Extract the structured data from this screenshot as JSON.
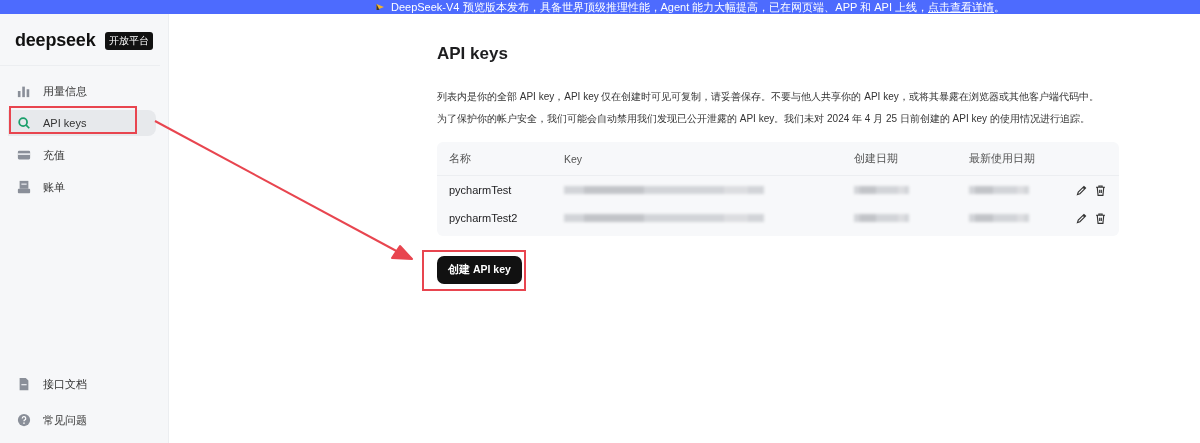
{
  "banner": {
    "text": "DeepSeek-V4 预览版本发布，具备世界顶级推理性能，Agent 能力大幅提高，已在网页端、APP 和 API 上线，",
    "link": "点击查看详情",
    "end": "。"
  },
  "sidebar": {
    "logo": "deepseek",
    "badge": "开放平台",
    "items": [
      {
        "label": "用量信息",
        "kind": "usage",
        "selected": false
      },
      {
        "label": "API keys",
        "kind": "keys",
        "selected": true
      },
      {
        "label": "充值",
        "kind": "topup",
        "selected": false
      },
      {
        "label": "账单",
        "kind": "bills",
        "selected": false
      }
    ],
    "bottom_items": [
      {
        "label": "接口文档",
        "kind": "docs",
        "selected": false
      },
      {
        "label": "常见问题",
        "kind": "faq",
        "selected": false
      }
    ]
  },
  "page": {
    "title": "API keys",
    "description": [
      "列表内是你的全部 API key，API key 仅在创建时可见可复制，请妥善保存。不要与他人共享你的 API key，或将其暴露在浏览器或其他客户端代码中。",
      "为了保护你的帐户安全，我们可能会自动禁用我们发现已公开泄露的 API key。我们未对 2024 年 4 月 25 日前创建的 API key 的使用情况进行追踪。"
    ],
    "table": {
      "columns": [
        "名称",
        "Key",
        "创建日期",
        "最新使用日期"
      ],
      "rows": [
        {
          "name": "pycharmTest"
        },
        {
          "name": "pycharmTest2"
        }
      ]
    },
    "create_button": "创建 API key"
  }
}
